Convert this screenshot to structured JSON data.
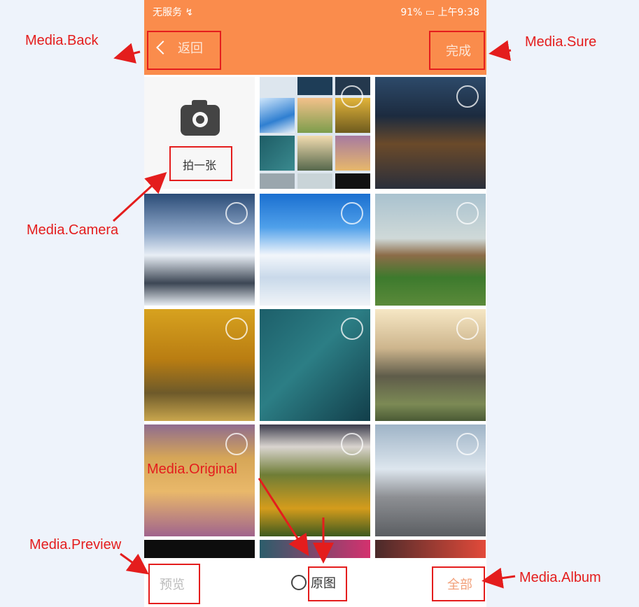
{
  "status": {
    "left": "无服务 ↯",
    "right": "91% ▭ 上午9:38"
  },
  "nav": {
    "back_label": "返回",
    "done_label": "完成"
  },
  "camera": {
    "label": "拍一张"
  },
  "bottom": {
    "preview": "预览",
    "original": "原图",
    "album": "全部"
  },
  "annotations": {
    "back": "Media.Back",
    "sure": "Media.Sure",
    "camera": "Media.Camera",
    "original": "Media.Original",
    "preview": "Media.Preview",
    "album": "Media.Album"
  },
  "colors": {
    "accent": "#fa8c4c",
    "annotation": "#e41d1d"
  }
}
